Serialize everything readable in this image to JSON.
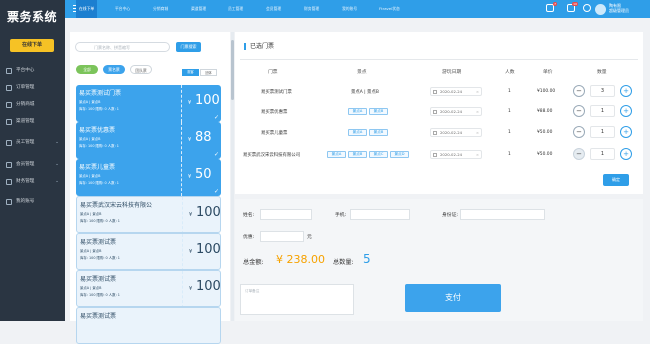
{
  "app_title": "票务系统",
  "sidebar": {
    "order_button": "在线下单",
    "items": [
      {
        "label": "平台中心",
        "icon": "home-icon"
      },
      {
        "label": "订单管理",
        "icon": "order-icon"
      },
      {
        "label": "分销商城",
        "icon": "shop-icon"
      },
      {
        "label": "渠道管理",
        "icon": "channel-icon"
      },
      {
        "label": "员工管理",
        "icon": "staff-icon",
        "expandable": true
      },
      {
        "label": "会员管理",
        "icon": "member-icon",
        "expandable": true
      },
      {
        "label": "财务管理",
        "icon": "finance-icon",
        "expandable": true
      },
      {
        "label": "我的账号",
        "icon": "account-icon"
      }
    ]
  },
  "topbar": {
    "tabs": [
      "在线下单",
      "平台中心",
      "分销商城",
      "渠道管理",
      "员工管理",
      "会员管理",
      "财务管理",
      "我的账号",
      "Ftravel状态"
    ],
    "active_tab": 0,
    "notification_badges": [
      "7",
      "10"
    ],
    "user_name": "陶有限",
    "user_role": "超级管理员"
  },
  "ticket_list": {
    "search_placeholder": "门票名称、拼音缩写",
    "search_button": "门票搜索",
    "filter_pills": [
      "全部",
      "票名票",
      "团队票"
    ],
    "segments": [
      "散客",
      "团体"
    ],
    "tickets": [
      {
        "name": "易买票测试门票",
        "row1": "景点A | 景点B",
        "row2": "库存: 100  限购: 0  人数: 1",
        "price": "100",
        "selected": true
      },
      {
        "name": "易买票优惠票",
        "row1": "景点A | 景点B",
        "row2": "库存: 100  限购: 0  人数: 1",
        "price": "88",
        "selected": true
      },
      {
        "name": "易买票儿童票",
        "row1": "景点A | 景点B",
        "row2": "库存: 100  限购: 0  人数: 1",
        "price": "50",
        "selected": true
      },
      {
        "name": "易买票武汉宋云科技有限公",
        "row1": "景点A | 景点B",
        "row2": "库存: 100  限购: 0  人数: 1",
        "price": "100",
        "selected": false
      },
      {
        "name": "易买票测试票",
        "row1": "景点A | 景点B",
        "row2": "库存: 100  限购: 0  人数: 1",
        "price": "100",
        "selected": false
      },
      {
        "name": "易买票测试票",
        "row1": "景点A | 景点B",
        "row2": "库存: 100  限购: 0  人数: 1",
        "price": "100",
        "selected": false
      },
      {
        "name": "易买票测试票",
        "row1": "",
        "row2": "",
        "price": "",
        "selected": false
      }
    ]
  },
  "selected_tickets": {
    "title": "已选门票",
    "headers": [
      "门票",
      "景点",
      "游玩日期",
      "人数",
      "单价",
      "数量"
    ],
    "rows": [
      {
        "ticket": "易买票测试门票",
        "scenic": "景点A | 景点B",
        "tags": [],
        "date": "2020-02-24",
        "people": "1",
        "price": "¥100.00",
        "qty": "3"
      },
      {
        "ticket": "易买票优惠票",
        "scenic": "",
        "tags": [
          "景点A",
          "景点B"
        ],
        "date": "2020-02-24",
        "people": "1",
        "price": "¥88.00",
        "qty": "1"
      },
      {
        "ticket": "易买票儿童票",
        "scenic": "",
        "tags": [
          "景点A",
          "景点B"
        ],
        "date": "2020-02-24",
        "people": "1",
        "price": "¥50.00",
        "qty": "1"
      },
      {
        "ticket": "易买票武汉宋云科技有限公司",
        "scenic": "",
        "tags": [
          "景点A",
          "景点B",
          "景点C",
          "景点D"
        ],
        "date": "2020-02-24",
        "people": "1",
        "price": "¥50.00",
        "qty": "1"
      }
    ],
    "confirm_button": "确定"
  },
  "form": {
    "name_label": "姓名:",
    "phone_label": "手机:",
    "id_label": "身份证:",
    "discount_label": "优惠:",
    "discount_unit": "元",
    "total_label": "总金额:",
    "total_amount": "¥ 238.00",
    "count_label": "总数量:",
    "count_value": "5"
  },
  "remark_placeholder": "订单备注",
  "pay_button": "支付",
  "colors": {
    "primary": "#2f9ee8",
    "sidebar": "#2a3542",
    "accent": "#f6c225",
    "amount": "#f6a200"
  }
}
